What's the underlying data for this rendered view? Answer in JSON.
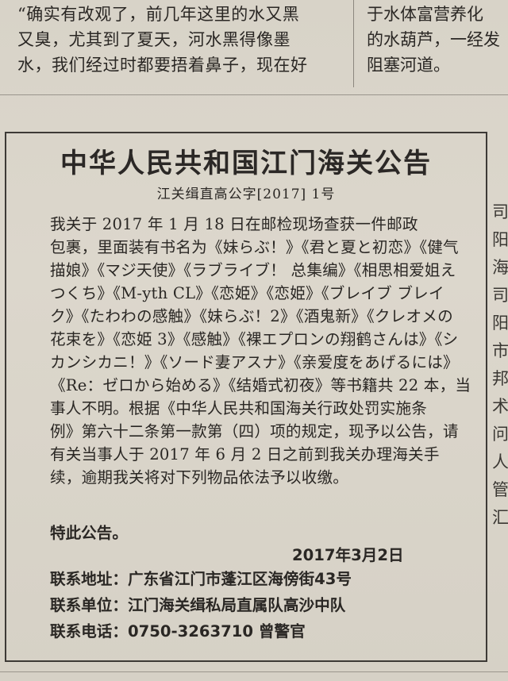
{
  "top_article": {
    "left_lines": [
      "“确实有改观了，前几年这里的水又黑",
      "又臭，尤其到了夏天，河水黑得像墨",
      "水，我们经过时都要捂着鼻子，现在好"
    ],
    "right_lines": [
      "于水体富营养化",
      "的水葫芦，一经发",
      "阻塞河道。"
    ]
  },
  "notice": {
    "title": "中华人民共和国江门海关公告",
    "doc_number": "江关缉直高公字[2017]  1号",
    "body_lines": [
      "    我关于 2017 年 1 月 18 日在邮检现场查获一件邮政",
      "包裹，里面装有书名为《妹らぶ！》《君と夏と初恋》《健气",
      "描娘》《マジ天使》《ラブライブ！ 总集编》《相思相爱姐え",
      "つくち》《M-yth CL》《恋姫》《恋姫》《ブレイブ ブレイ",
      "ク》《たわわの感触》《妹らぶ！2》《酒鬼新》《クレオメの",
      "花束を》《恋姫 3》《感触》《裸エプロンの翔鹤さんは》《シ",
      "カンシカニ！》《ソード妻アスナ》《亲爱度をあげるには》",
      "《Re：ゼロから始める》《结婚式初夜》等书籍共 22 本，当",
      "事人不明。根据《中华人民共和国海关行政处罚实施条",
      "例》第六十二条第一款第（四）项的规定，现予以公告，请",
      "有关当事人于 2017 年 6 月 2 日之前到我关办理海关手",
      "续，逾期我关将对下列物品依法予以收缴。"
    ],
    "closing": "特此公告。",
    "date": "2017年3月2日",
    "address": "联系地址：广东省江门市蓬江区海傍街43号",
    "unit": "联系单位：江门海关缉私局直属队高沙中队",
    "phone": "联系电话：0750-3263710      曾警官"
  },
  "right_column_fragment": [
    "司",
    "阳",
    "海",
    "司",
    "阳",
    "市",
    "邦",
    "术",
    "问",
    "人",
    "管",
    "汇"
  ]
}
